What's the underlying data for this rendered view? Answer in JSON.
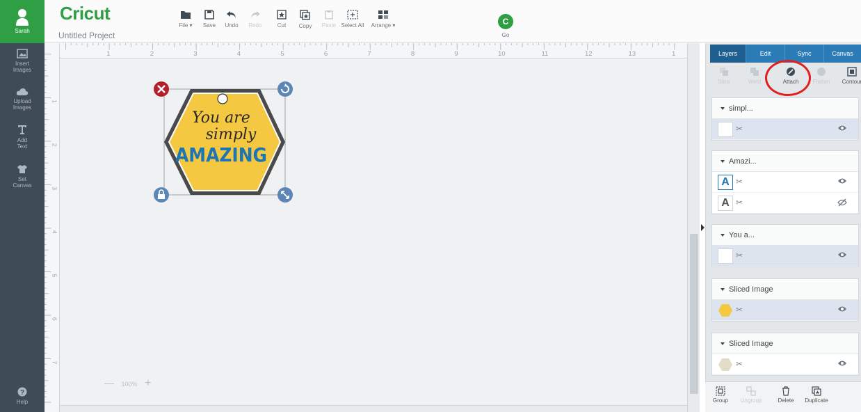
{
  "user": {
    "name": "Sarah"
  },
  "app": {
    "logo": "Cricut",
    "project_title": "Untitled Project"
  },
  "sidebar": {
    "insert_images": [
      "Insert",
      "Images"
    ],
    "upload_images": [
      "Upload",
      "Images"
    ],
    "add_text": [
      "Add",
      "Text"
    ],
    "set_canvas": [
      "Set",
      "Canvas"
    ],
    "help": "Help"
  },
  "toolbar": {
    "file": "File ▾",
    "save": "Save",
    "undo": "Undo",
    "redo": "Redo",
    "cut": "Cut",
    "copy": "Copy",
    "paste": "Paste",
    "select_all": "Select All",
    "arrange": "Arrange ▾",
    "go_icon": "C",
    "go": "Go"
  },
  "ruler": {
    "top_ticks": [
      "1",
      "2",
      "3",
      "4",
      "5",
      "6",
      "7",
      "8",
      "9",
      "10",
      "11",
      "12",
      "13",
      "1"
    ],
    "left_ticks": [
      "1",
      "2",
      "3",
      "4",
      "5",
      "6",
      "7"
    ]
  },
  "design": {
    "line1": "You are",
    "line2": "simply",
    "line3": "AMAZING"
  },
  "zoom": {
    "value": "100%"
  },
  "panel": {
    "tabs": [
      "Layers",
      "Edit",
      "Sync",
      "Canvas"
    ],
    "tools": {
      "slice": "Slice",
      "weld": "Weld",
      "attach": "Attach",
      "flatten": "Flatten",
      "contour": "Contour"
    },
    "groups": [
      {
        "name": "simpl..."
      },
      {
        "name": "Amazi..."
      },
      {
        "name": "You a..."
      },
      {
        "name": "Sliced Image"
      },
      {
        "name": "Sliced Image"
      }
    ],
    "bottom": {
      "group": "Group",
      "ungroup": "Ungroup",
      "delete": "Delete",
      "duplicate": "Duplicate"
    }
  },
  "colors": {
    "brand": "#2f9e44",
    "tab_blue": "#2a7bb6",
    "highlight_circle": "#e0201f",
    "hex_fill": "#f5c842",
    "amazing_text": "#1d75b3"
  }
}
